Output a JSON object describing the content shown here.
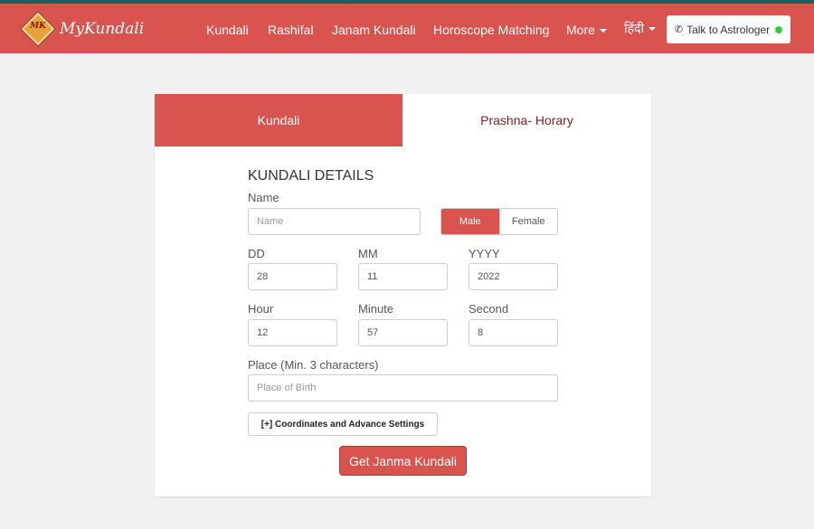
{
  "header": {
    "logo_text": "MyKundali",
    "logo_mark": "MK",
    "nav": [
      {
        "label": "Kundali"
      },
      {
        "label": "Rashifal"
      },
      {
        "label": "Janam Kundali"
      },
      {
        "label": "Horoscope Matching"
      },
      {
        "label": "More"
      },
      {
        "label": "हिंदी"
      }
    ],
    "talk_button": "Talk to Astrologer",
    "phone_icon": "phone-icon",
    "status_color": "#2ecc40",
    "accent_color": "#d9534f"
  },
  "tabs": [
    {
      "label": "Kundali",
      "active": true
    },
    {
      "label": "Prashna- Horary",
      "active": false
    }
  ],
  "form": {
    "title": "KUNDALI DETAILS",
    "name": {
      "label": "Name",
      "placeholder": "Name",
      "value": ""
    },
    "gender": {
      "male": "Male",
      "female": "Female",
      "selected": "Male"
    },
    "dd": {
      "label": "DD",
      "value": "28"
    },
    "mm": {
      "label": "MM",
      "value": "11"
    },
    "yyyy": {
      "label": "YYYY",
      "value": "2022"
    },
    "hour": {
      "label": "Hour",
      "value": "12"
    },
    "minute": {
      "label": "Minute",
      "value": "57"
    },
    "second": {
      "label": "Second",
      "value": "8"
    },
    "place": {
      "label": "Place (Min. 3 characters)",
      "placeholder": "Place of Birth",
      "value": ""
    },
    "advanced_button": "[+] Coordinates and Advance Settings",
    "submit_button": "Get Janma Kundali"
  }
}
